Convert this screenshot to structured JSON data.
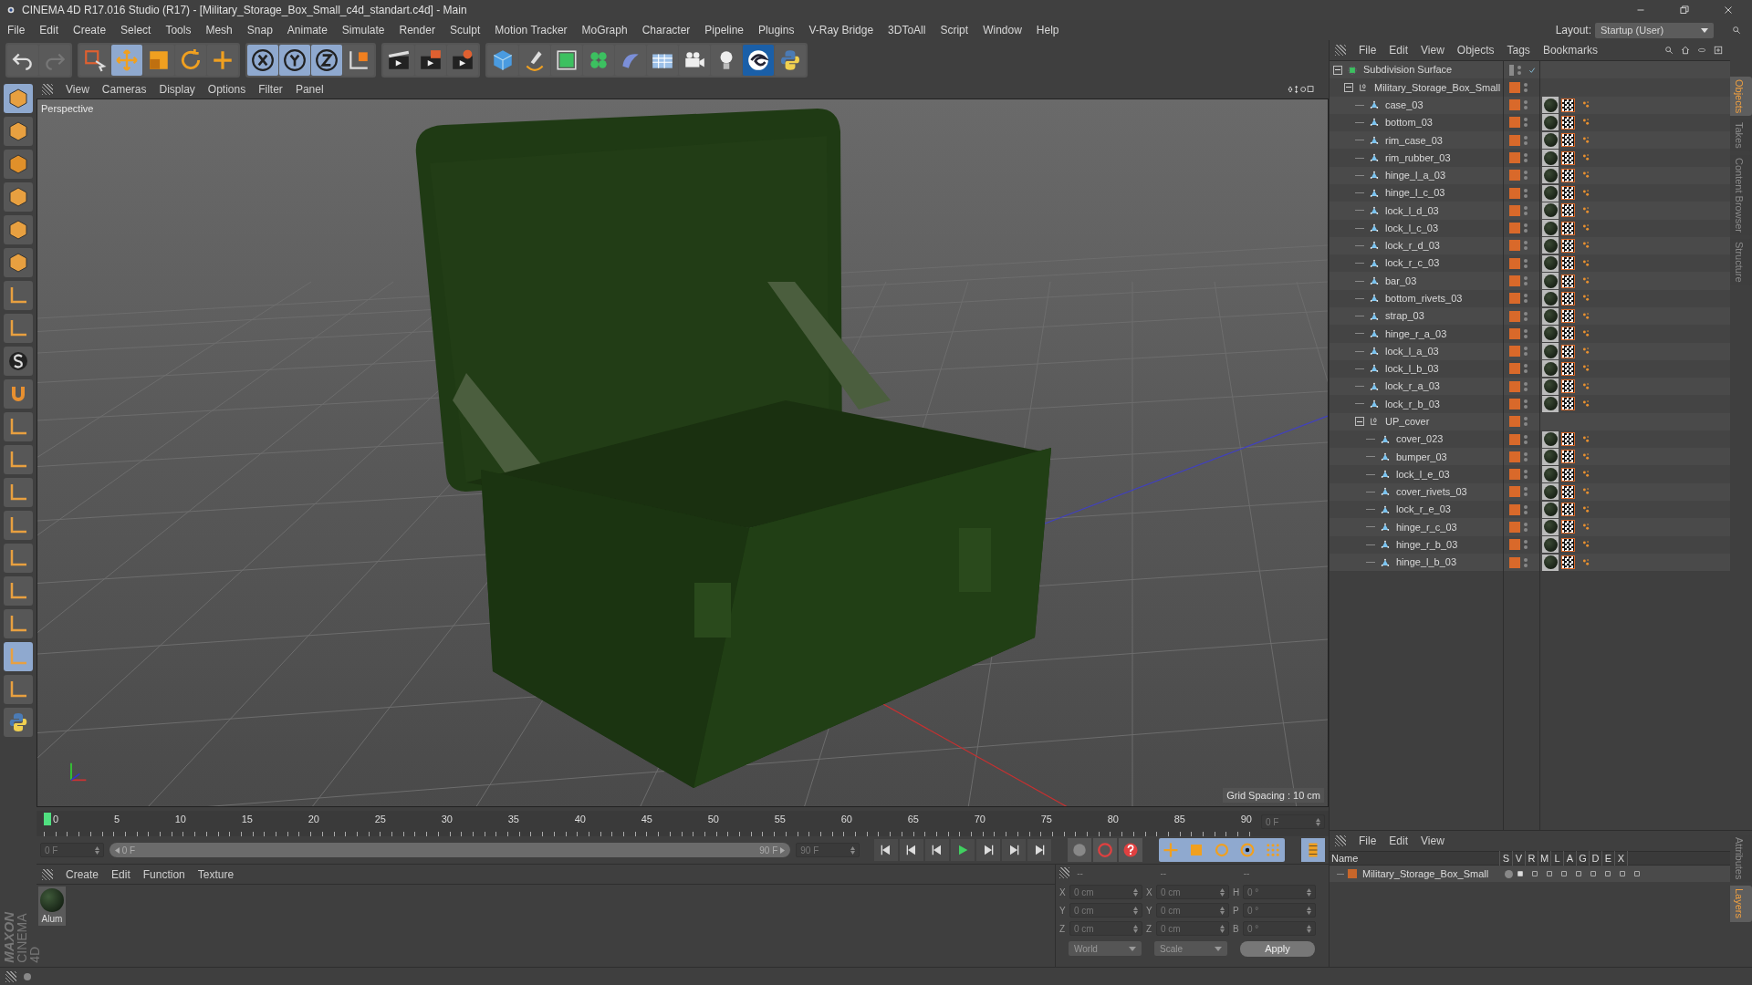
{
  "window": {
    "title": "CINEMA 4D R17.016 Studio (R17) - [Military_Storage_Box_Small_c4d_standart.c4d] - Main"
  },
  "menu": [
    "File",
    "Edit",
    "Create",
    "Select",
    "Tools",
    "Mesh",
    "Snap",
    "Animate",
    "Simulate",
    "Render",
    "Sculpt",
    "Motion Tracker",
    "MoGraph",
    "Character",
    "Pipeline",
    "Plugins",
    "V-Ray Bridge",
    "3DToAll",
    "Script",
    "Window",
    "Help"
  ],
  "layout": {
    "label": "Layout:",
    "value": "Startup (User)"
  },
  "viewport": {
    "menu": [
      "View",
      "Cameras",
      "Display",
      "Options",
      "Filter",
      "Panel"
    ],
    "camera": "Perspective",
    "grid_spacing": "Grid Spacing : 10 cm"
  },
  "object_manager": {
    "menu": [
      "File",
      "Edit",
      "View",
      "Objects",
      "Tags",
      "Bookmarks"
    ],
    "tree": [
      {
        "name": "Subdivision Surface",
        "kind": "generator",
        "expanded": true,
        "children": [
          {
            "name": "Military_Storage_Box_Small",
            "kind": "null",
            "expanded": true,
            "children": [
              {
                "name": "case_03",
                "kind": "polygon"
              },
              {
                "name": "bottom_03",
                "kind": "polygon"
              },
              {
                "name": "rim_case_03",
                "kind": "polygon"
              },
              {
                "name": "rim_rubber_03",
                "kind": "polygon"
              },
              {
                "name": "hinge_l_a_03",
                "kind": "polygon"
              },
              {
                "name": "hinge_l_c_03",
                "kind": "polygon"
              },
              {
                "name": "lock_l_d_03",
                "kind": "polygon"
              },
              {
                "name": "lock_l_c_03",
                "kind": "polygon"
              },
              {
                "name": "lock_r_d_03",
                "kind": "polygon"
              },
              {
                "name": "lock_r_c_03",
                "kind": "polygon"
              },
              {
                "name": "bar_03",
                "kind": "polygon"
              },
              {
                "name": "bottom_rivets_03",
                "kind": "polygon"
              },
              {
                "name": "strap_03",
                "kind": "polygon"
              },
              {
                "name": "hinge_r_a_03",
                "kind": "polygon"
              },
              {
                "name": "lock_l_a_03",
                "kind": "polygon"
              },
              {
                "name": "lock_l_b_03",
                "kind": "polygon"
              },
              {
                "name": "lock_r_a_03",
                "kind": "polygon"
              },
              {
                "name": "lock_r_b_03",
                "kind": "polygon"
              },
              {
                "name": "UP_cover",
                "kind": "null",
                "expanded": true,
                "children": [
                  {
                    "name": "cover_023",
                    "kind": "polygon"
                  },
                  {
                    "name": "bumper_03",
                    "kind": "polygon"
                  },
                  {
                    "name": "lock_l_e_03",
                    "kind": "polygon"
                  },
                  {
                    "name": "cover_rivets_03",
                    "kind": "polygon"
                  },
                  {
                    "name": "lock_r_e_03",
                    "kind": "polygon"
                  },
                  {
                    "name": "hinge_r_c_03",
                    "kind": "polygon"
                  },
                  {
                    "name": "hinge_r_b_03",
                    "kind": "polygon"
                  },
                  {
                    "name": "hinge_l_b_03",
                    "kind": "polygon"
                  }
                ]
              }
            ]
          }
        ]
      }
    ]
  },
  "side_tabs": [
    {
      "label": "Objects",
      "selected": true
    },
    {
      "label": "Takes",
      "selected": false
    },
    {
      "label": "Content Browser",
      "selected": false
    },
    {
      "label": "Structure",
      "selected": false
    }
  ],
  "timeline": {
    "ruler_labels": [
      "0",
      "5",
      "10",
      "15",
      "20",
      "25",
      "30",
      "35",
      "40",
      "45",
      "50",
      "55",
      "60",
      "65",
      "70",
      "75",
      "80",
      "85",
      "90"
    ],
    "current_frame": "0 F",
    "start_field": "0 F",
    "range": {
      "start": "0 F",
      "end": "90 F",
      "level": 1
    },
    "end_field": "90 F"
  },
  "materials": {
    "menu": [
      "Create",
      "Edit",
      "Function",
      "Texture"
    ],
    "items": [
      {
        "name": "Alum"
      }
    ]
  },
  "coordinates": {
    "headers": [
      "--",
      "--",
      "--"
    ],
    "columns": [
      [
        {
          "axis": "X",
          "value": "0 cm"
        },
        {
          "axis": "Y",
          "value": "0 cm"
        },
        {
          "axis": "Z",
          "value": "0 cm"
        }
      ],
      [
        {
          "axis": "X",
          "value": "0 cm"
        },
        {
          "axis": "Y",
          "value": "0 cm"
        },
        {
          "axis": "Z",
          "value": "0 cm"
        }
      ],
      [
        {
          "axis": "H",
          "value": "0 °"
        },
        {
          "axis": "P",
          "value": "0 °"
        },
        {
          "axis": "B",
          "value": "0 °"
        }
      ]
    ],
    "dropdowns": [
      "World",
      "Scale"
    ],
    "apply": "Apply"
  },
  "layers": {
    "menu": [
      "File",
      "Edit",
      "View"
    ],
    "columns": [
      "Name",
      "S",
      "V",
      "R",
      "M",
      "L",
      "A",
      "G",
      "D",
      "E",
      "X"
    ],
    "rows": [
      {
        "name": "Military_Storage_Box_Small",
        "color": "#c8662a"
      }
    ]
  },
  "bottom_tabs": [
    {
      "label": "Attributes",
      "selected": false
    },
    {
      "label": "Layers",
      "selected": true
    }
  ],
  "logo": {
    "brand": "MAXON",
    "product": "CINEMA 4D"
  }
}
